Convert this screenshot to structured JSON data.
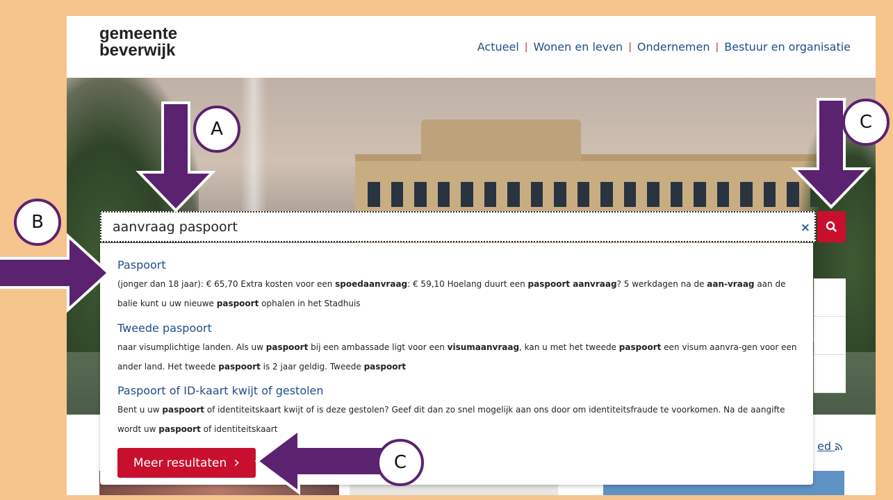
{
  "logo": {
    "line1": "gemeente",
    "line2": "beverwijk"
  },
  "nav": [
    {
      "label": "Actueel"
    },
    {
      "label": "Wonen en leven"
    },
    {
      "label": "Ondernemen"
    },
    {
      "label": "Bestuur en organisatie"
    }
  ],
  "search": {
    "value": "aanvraag paspoort",
    "clear_icon": "×"
  },
  "results": [
    {
      "title": "Paspoort",
      "snippet": [
        {
          "t": "(jonger dan 18 jaar):  € 65,70 Extra kosten voor een "
        },
        {
          "t": "spoedaanvraag",
          "b": true
        },
        {
          "t": ":  € 59,10 Hoelang duurt een "
        },
        {
          "t": "paspoort aanvraag",
          "b": true
        },
        {
          "t": "? 5 werkdagen na de "
        },
        {
          "t": "aan-vraag",
          "b": true
        },
        {
          "t": " aan de balie kunt u uw nieuwe "
        },
        {
          "t": "paspoort",
          "b": true
        },
        {
          "t": " ophalen in het Stadhuis"
        }
      ]
    },
    {
      "title": "Tweede paspoort",
      "snippet": [
        {
          "t": "naar visumplichtige landen. Als uw "
        },
        {
          "t": "paspoort",
          "b": true
        },
        {
          "t": " bij een ambassade ligt voor een "
        },
        {
          "t": "visumaanvraag",
          "b": true
        },
        {
          "t": ", kan u met het tweede "
        },
        {
          "t": "paspoort",
          "b": true
        },
        {
          "t": " een visum aanvra-gen voor een ander land. Het tweede "
        },
        {
          "t": "paspoort",
          "b": true
        },
        {
          "t": " is 2 jaar geldig. Tweede "
        },
        {
          "t": "paspoort",
          "b": true
        }
      ]
    },
    {
      "title": "Paspoort of ID-kaart kwijt of gestolen",
      "snippet": [
        {
          "t": "Bent u uw "
        },
        {
          "t": "paspoort",
          "b": true
        },
        {
          "t": " of identiteitskaart kwijt of is deze gestolen? Geef dit dan zo snel mogelijk aan ons door om identiteitsfraude te voorkomen. Na de aangifte wordt uw "
        },
        {
          "t": "paspoort",
          "b": true
        },
        {
          "t": " of identiteitskaart"
        }
      ]
    }
  ],
  "more_results": {
    "label": "Meer resultaten",
    "chevron": "›"
  },
  "rss_link": {
    "label": "ed"
  },
  "annotations": {
    "a": "A",
    "b": "B",
    "c1": "C",
    "c2": "C"
  },
  "colors": {
    "frame": "#f6c48d",
    "accent": "#c8102e",
    "link": "#234d8a",
    "annotation": "#5b2270"
  }
}
